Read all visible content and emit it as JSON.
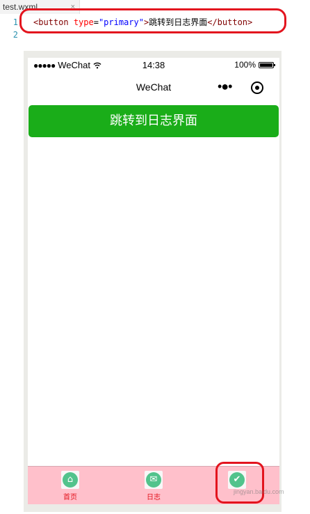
{
  "editor": {
    "file_tab": "test.wxml",
    "close_glyph": "×",
    "line_numbers": [
      "1",
      "2"
    ],
    "code": {
      "open_tag": "<button",
      "attr_name": "type",
      "equals": "=",
      "attr_value": "\"primary\"",
      "tag_close": ">",
      "text": "跳转到日志界面",
      "end_tag": "</button>"
    }
  },
  "status_bar": {
    "signal_dots": "●●●●●",
    "carrier": "WeChat",
    "wifi_icon": "wifi-icon",
    "time": "14:38",
    "battery": "100%"
  },
  "nav_bar": {
    "title": "WeChat",
    "more_glyph": "•●•"
  },
  "primary_button": {
    "label": "跳转到日志界面",
    "color": "#1aad19"
  },
  "tab_bar": {
    "background": "#ffc0cb",
    "label_color": "#e3141e",
    "items": [
      {
        "label": "首页",
        "icon": "home-icon",
        "glyph": "⌂"
      },
      {
        "label": "日志",
        "icon": "mail-icon",
        "glyph": "✉"
      },
      {
        "label": "",
        "icon": "check-icon",
        "glyph": "✔"
      }
    ]
  },
  "watermark": "jingyan.baidu.com"
}
